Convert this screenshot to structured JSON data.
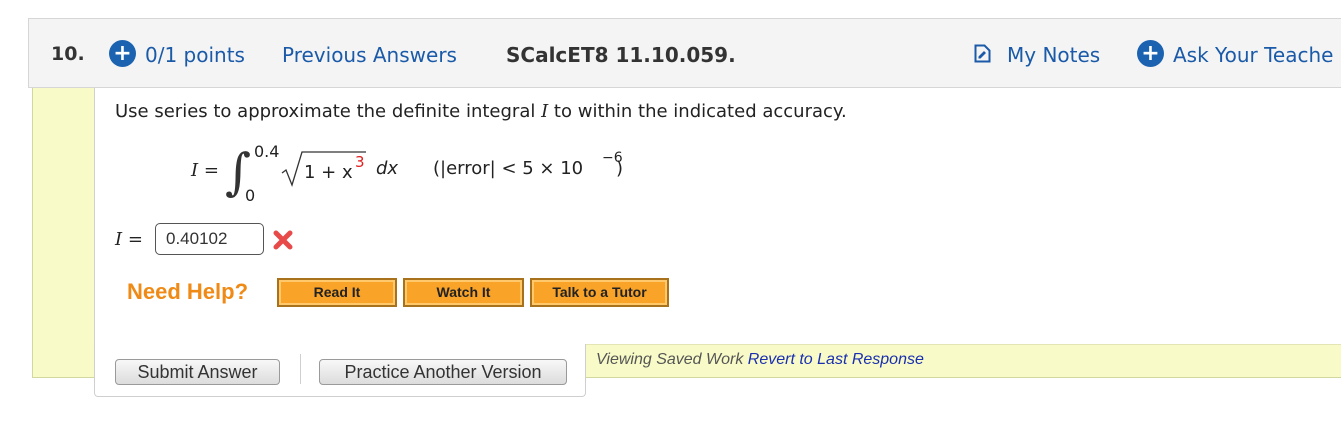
{
  "question": {
    "number": "10.",
    "points": "0/1 points",
    "previous_answers": "Previous Answers",
    "reference": "SCalcET8 11.10.059.",
    "my_notes": "My Notes",
    "ask_teacher": "Ask Your Teache"
  },
  "prompt": {
    "before": "Use series to approximate the definite integral ",
    "var": "I",
    "after": " to within the indicated accuracy."
  },
  "formula": {
    "lhs": "I =",
    "integral_sign": "∫",
    "upper_limit": "0.4",
    "lower_limit": "0",
    "radicand": "1 + x",
    "exponent": "3",
    "differential": "dx",
    "accuracy": "(|error| < 5 × 10",
    "accuracy_exponent": "−6",
    "accuracy_close": ")"
  },
  "answer": {
    "label": "I =",
    "value": "0.40102",
    "status_icon": "incorrect-x-icon",
    "status_color": "#e84a4a"
  },
  "help": {
    "label": "Need Help?",
    "buttons": [
      "Read It",
      "Watch It",
      "Talk to a Tutor"
    ]
  },
  "footer": {
    "submit": "Submit Answer",
    "practice": "Practice Another Version",
    "viewing": "Viewing Saved Work ",
    "revert": "Revert to Last Response"
  },
  "colors": {
    "link": "#1a5aa8",
    "icon_blue": "#1b63b0",
    "help_orange": "#f08a16",
    "panel_yellow": "#f8fbc8"
  }
}
